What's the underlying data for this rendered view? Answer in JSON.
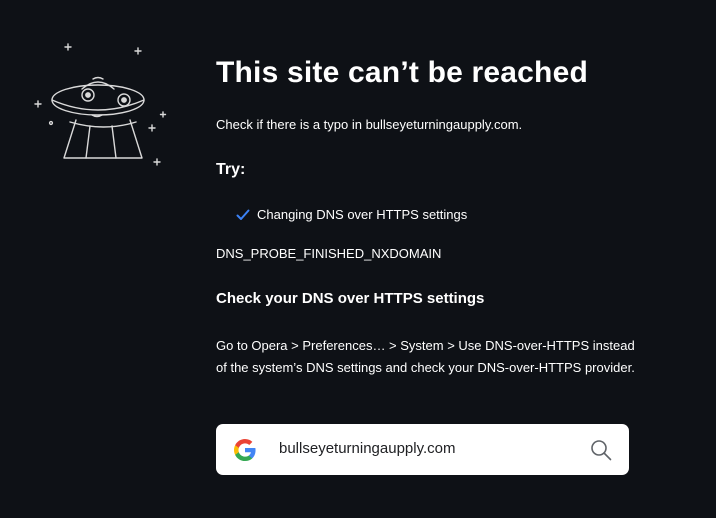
{
  "error_page": {
    "title": "This site can’t be reached",
    "typo_message": "Check if there is a typo in bullseyeturningaupply.com.",
    "try_heading": "Try:",
    "suggestions": [
      {
        "label": "Changing DNS over HTTPS settings",
        "icon": "check-icon"
      }
    ],
    "error_code": "DNS_PROBE_FINISHED_NXDOMAIN",
    "doh_heading": "Check your DNS over HTTPS settings",
    "doh_instructions": "Go to Opera > Preferences… > System > Use DNS-over-HTTPS instead of the system’s DNS settings and check your DNS-over-HTTPS provider.",
    "illustration": "ufo-illustration"
  },
  "search": {
    "value": "bullseyeturningaupply.com",
    "logo": "google-logo",
    "icon": "search-icon"
  },
  "colors": {
    "background": "#0e1116",
    "text": "#ffffff",
    "check_accent": "#3b82f6"
  }
}
